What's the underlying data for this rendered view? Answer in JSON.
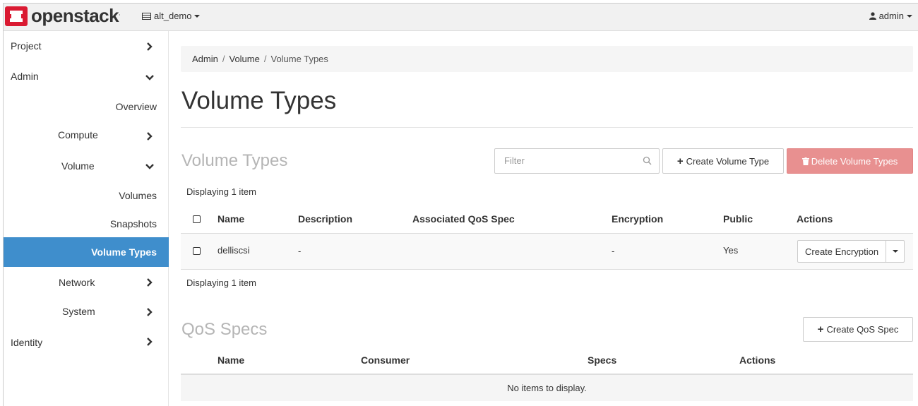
{
  "topbar": {
    "brand": "openstack",
    "brand_tm": ".",
    "project": "alt_demo",
    "user": "admin"
  },
  "sidebar": {
    "project": "Project",
    "admin": "Admin",
    "overview": "Overview",
    "compute": "Compute",
    "volume": "Volume",
    "volumes": "Volumes",
    "snapshots": "Snapshots",
    "volume_types": "Volume Types",
    "network": "Network",
    "system": "System",
    "identity": "Identity"
  },
  "breadcrumb": {
    "admin": "Admin",
    "volume": "Volume",
    "current": "Volume Types",
    "separator": "/"
  },
  "page_title": "Volume Types",
  "volume_types": {
    "heading": "Volume Types",
    "filter_placeholder": "Filter",
    "create_button": "Create Volume Type",
    "delete_button": "Delete Volume Types",
    "count_top": "Displaying 1 item",
    "count_bottom": "Displaying 1 item",
    "columns": {
      "name": "Name",
      "description": "Description",
      "qos": "Associated QoS Spec",
      "encryption": "Encryption",
      "public": "Public",
      "actions": "Actions"
    },
    "rows": [
      {
        "name": "delliscsi",
        "description": "-",
        "qos": "",
        "encryption": "-",
        "public": "Yes",
        "action": "Create Encryption"
      }
    ]
  },
  "qos_specs": {
    "heading": "QoS Specs",
    "create_button": "Create QoS Spec",
    "columns": {
      "name": "Name",
      "consumer": "Consumer",
      "specs": "Specs",
      "actions": "Actions"
    },
    "empty": "No items to display."
  },
  "colors": {
    "active_nav": "#3f8ecc",
    "danger": "#e89090",
    "brand_red": "#da1a32"
  },
  "icons": {
    "project_selector": "server-icon",
    "user": "user-icon",
    "filter": "search-icon",
    "delete": "trash-icon",
    "create": "plus-icon"
  }
}
